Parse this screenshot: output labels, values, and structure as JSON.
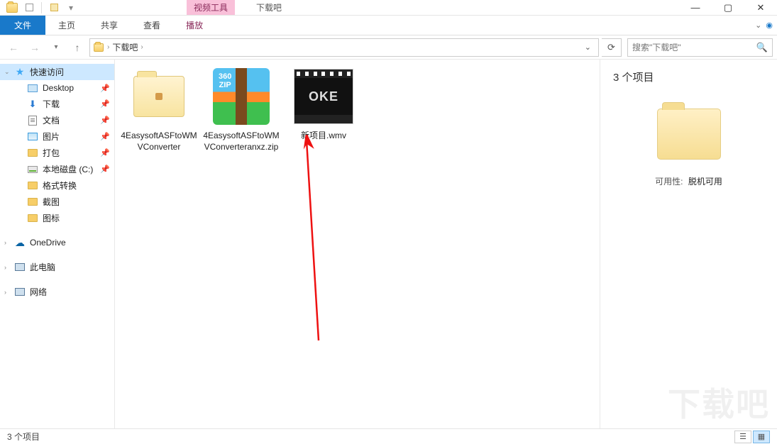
{
  "titlebar": {
    "context_tab": "视频工具",
    "window_title": "下载吧"
  },
  "ribbon": {
    "file": "文件",
    "tabs": [
      "主页",
      "共享",
      "查看",
      "播放"
    ]
  },
  "address": {
    "crumbs": [
      "下载吧"
    ],
    "search_placeholder": "搜索\"下载吧\""
  },
  "sidebar": {
    "quick_access": "快速访问",
    "items": [
      {
        "label": "Desktop",
        "pinned": true
      },
      {
        "label": "下载",
        "pinned": true
      },
      {
        "label": "文档",
        "pinned": true
      },
      {
        "label": "图片",
        "pinned": true
      },
      {
        "label": "打包",
        "pinned": true
      },
      {
        "label": "本地磁盘 (C:)",
        "pinned": true
      },
      {
        "label": "格式转换"
      },
      {
        "label": "截图"
      },
      {
        "label": "图标"
      }
    ],
    "onedrive": "OneDrive",
    "this_pc": "此电脑",
    "network": "网络"
  },
  "files": [
    {
      "name": "4EasysoftASFtoWMVConverter",
      "type": "folder"
    },
    {
      "name": "4EasysoftASFtoWMVConverteranxz.zip",
      "type": "zip"
    },
    {
      "name": "新项目.wmv",
      "type": "video"
    }
  ],
  "details": {
    "count_label": "3 个项目",
    "availability_label": "可用性:",
    "availability_value": "脱机可用"
  },
  "statusbar": {
    "count": "3 个项目"
  },
  "zip_icon": {
    "line1": "360",
    "line2": "ZIP"
  },
  "video_frame_text": "OKE",
  "watermark": "下载吧"
}
